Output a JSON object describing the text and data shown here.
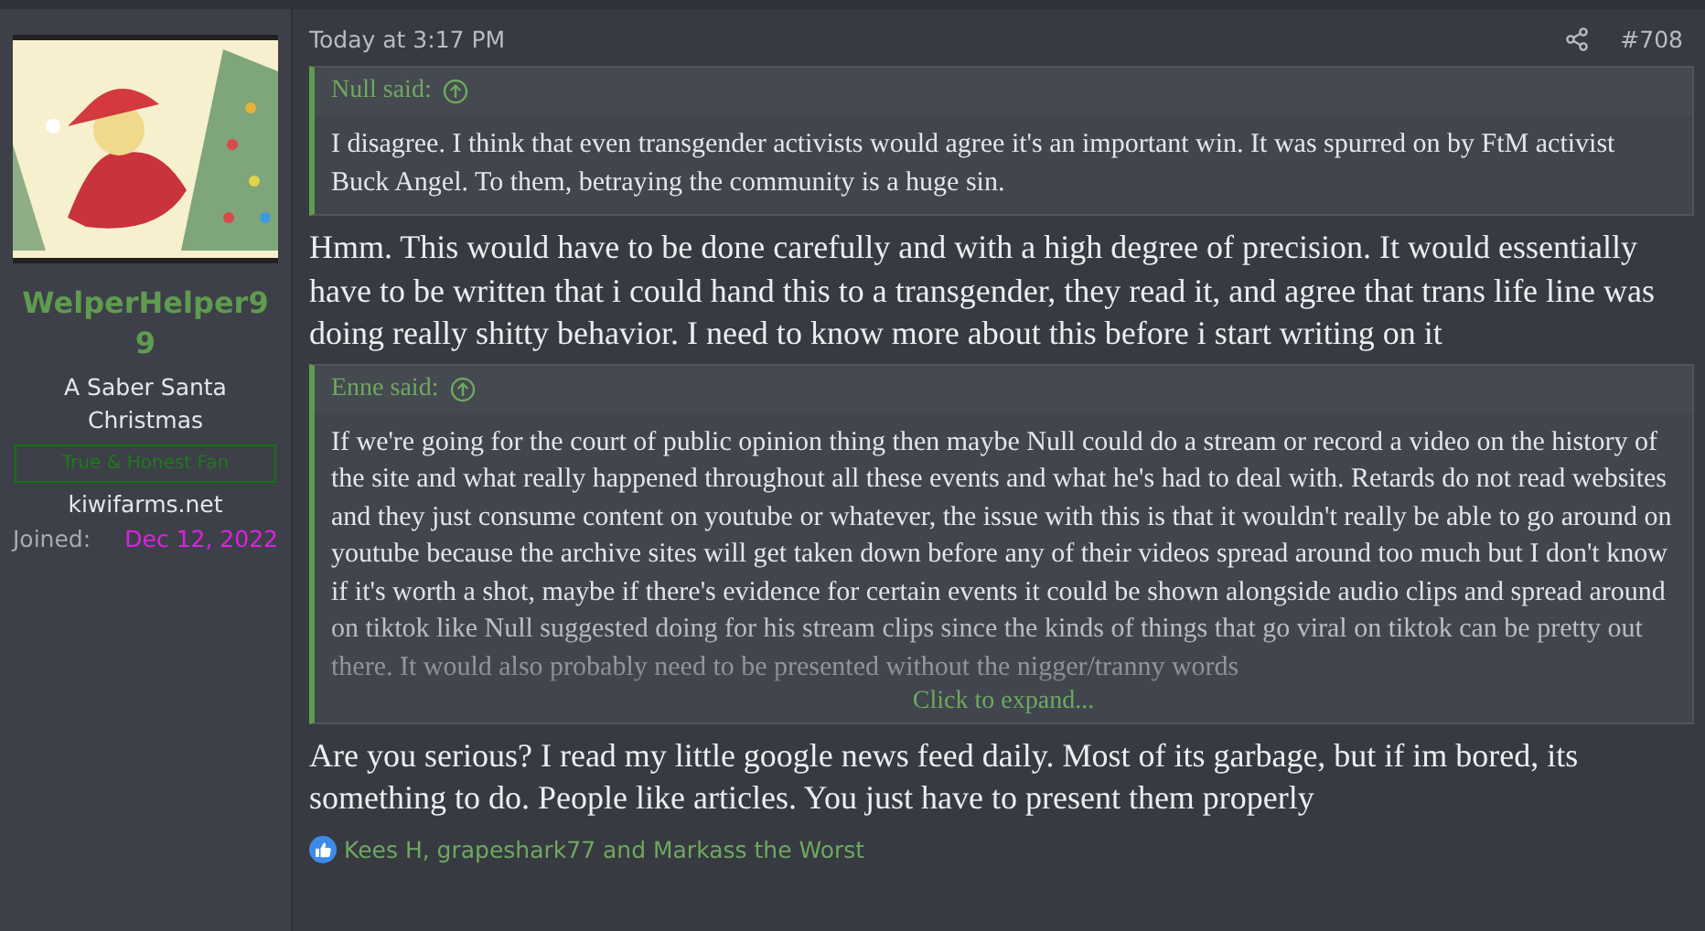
{
  "user": {
    "name": "WelperHelper99",
    "title": "A Saber Santa Christmas",
    "banner": "True & Honest Fan",
    "site": "kiwifarms.net",
    "joined_label": "Joined:",
    "joined_date": "Dec 12, 2022"
  },
  "post": {
    "time": "Today at 3:17 PM",
    "number": "#708",
    "content": [
      {
        "kind": "quote",
        "author": "Null said:",
        "text": "I disagree. I think that even transgender activists would agree it's an important win. It was spurred on by FtM activist Buck Angel. To them, betraying the community is a huge sin.",
        "expanded": true
      },
      {
        "kind": "text",
        "text": "Hmm. This would have to be done carefully and with a high degree of precision. It would essentially have to be written that i could hand this to a transgender, they read it, and agree that trans life line was doing really shitty behavior. I need to know more about this before i start writing on it"
      },
      {
        "kind": "quote",
        "author": "Enne said:",
        "text": "If we're going for the court of public opinion thing then maybe Null could do a stream or record a video on the history of the site and what really happened throughout all these events and what he's had to deal with. Retards do not read websites and they just consume content on youtube or whatever, the issue with this is that it wouldn't really be able to go around on youtube because the archive sites will get taken down before any of their videos spread around too much but I don't know if it's worth a shot, maybe if there's evidence for certain events it could be shown alongside audio clips and spread around on tiktok like Null suggested doing for his stream clips since the kinds of things that go viral on tiktok can be pretty out there. It would also probably need to be presented without the nigger/tranny words",
        "expanded": false,
        "expand_label": "Click to expand..."
      },
      {
        "kind": "text",
        "text": "Are you serious? I read my little google news feed daily. Most of its garbage, but if im bored, its something to do. People like articles. You just have to present them properly"
      }
    ],
    "reactions": "Kees H, grapeshark77 and Markass the Worst"
  }
}
